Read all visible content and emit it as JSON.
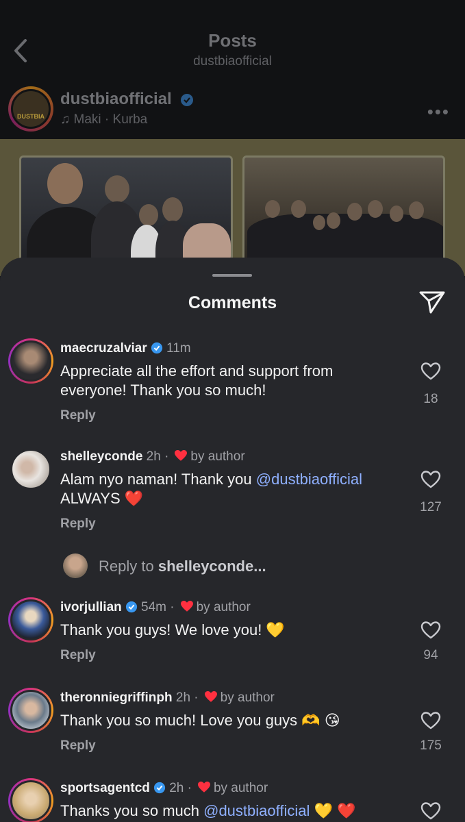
{
  "header": {
    "title": "Posts",
    "subtitle": "dustbiaofficial"
  },
  "post": {
    "username": "dustbiaofficial",
    "music": "Maki · Kurba",
    "avatar_text": "DUSTBIA"
  },
  "sheet": {
    "title": "Comments"
  },
  "comments": [
    {
      "username": "maecruzalviar",
      "verified": true,
      "time": "11m",
      "by_author": "",
      "text": "Appreciate all the effort and support from everyone! Thank you so much!",
      "reply_label": "Reply",
      "likes": "18"
    },
    {
      "username": "shelleyconde",
      "verified": false,
      "time": "2h ·",
      "by_author": "by author",
      "text_before": "Alam nyo naman! Thank you ",
      "mention": "@dustbiaofficial",
      "text_after": " ALWAYS ❤️",
      "reply_label": "Reply",
      "likes": "127"
    },
    {
      "username": "ivorjullian",
      "verified": true,
      "time": "54m ·",
      "by_author": "by author",
      "text": "Thank you guys! We love you! 💛",
      "reply_label": "Reply",
      "likes": "94"
    },
    {
      "username": "theronniegriffinph",
      "verified": false,
      "time": "2h ·",
      "by_author": "by author",
      "text": "Thank you so much! Love you guys 🫶 😘",
      "reply_label": "Reply",
      "likes": "175"
    },
    {
      "username": "sportsagentcd",
      "verified": true,
      "time": "2h ·",
      "by_author": "by author",
      "text_before": "Thanks you so much ",
      "mention": "@dustbiaofficial",
      "text_after": " 💛 ❤️",
      "reply_label": "",
      "likes": ""
    }
  ],
  "reply_to": {
    "prefix": "Reply to ",
    "username": "shelleyconde..."
  },
  "colors": {
    "sheet_bg": "#26272b",
    "mention": "#8fb0ff",
    "heart": "#ff3040",
    "verified": "#3897f0"
  }
}
